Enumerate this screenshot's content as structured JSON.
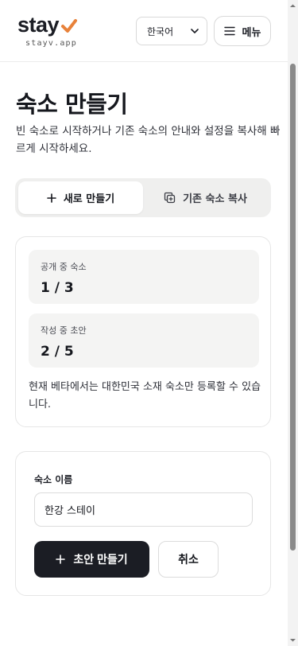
{
  "header": {
    "logo_text": "stay",
    "logo_domain": "stayv.app",
    "language": "한국어",
    "menu_label": "메뉴"
  },
  "page": {
    "title": "숙소 만들기",
    "description": "빈 숙소로 시작하거나 기존 숙소의 안내와 설정을 복사해 빠르게 시작하세요."
  },
  "tabs": [
    {
      "label": "새로 만들기",
      "icon": "plus-icon",
      "active": true
    },
    {
      "label": "기존 숙소 복사",
      "icon": "copy-icon",
      "active": false
    }
  ],
  "stats": [
    {
      "label": "공개 중 숙소",
      "value": "1 / 3"
    },
    {
      "label": "작성 중 초안",
      "value": "2 / 5"
    }
  ],
  "stats_note": "현재 베타에서는 대한민국 소재 숙소만 등록할 수 있습니다.",
  "form": {
    "name_label": "숙소 이름",
    "name_value": "한강 스테이",
    "create_label": "초안 만들기",
    "cancel_label": "취소"
  },
  "colors": {
    "accent": "#e8823a",
    "primary_button": "#1b1d24",
    "tab_track": "#efefee",
    "stat_bg": "#f4f4f3"
  }
}
